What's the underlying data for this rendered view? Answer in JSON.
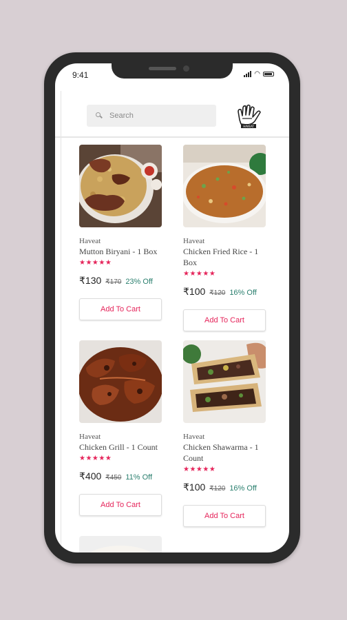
{
  "status_bar": {
    "time": "9:41"
  },
  "search": {
    "placeholder": "Search"
  },
  "theme": {
    "accent": "#e5245a",
    "discount": "#2a7f6e"
  },
  "products": [
    {
      "brand": "Haveat",
      "name": "Mutton Biryani - 1 Box",
      "rating": "★★★★★",
      "price": "₹130",
      "mrp": "₹170",
      "discount": "23% Off",
      "button": "Add To Cart",
      "image": "mutton-biryani"
    },
    {
      "brand": "Haveat",
      "name": "Chicken Fried Rice - 1 Box",
      "rating": "★★★★★",
      "price": "₹100",
      "mrp": "₹120",
      "discount": "16% Off",
      "button": "Add To Cart",
      "image": "chicken-fried-rice"
    },
    {
      "brand": "Haveat",
      "name": "Chicken Grill - 1 Count",
      "rating": "★★★★★",
      "price": "₹400",
      "mrp": "₹450",
      "discount": "11% Off",
      "button": "Add To Cart",
      "image": "chicken-grill"
    },
    {
      "brand": "Haveat",
      "name": "Chicken Shawarma - 1 Count",
      "rating": "★★★★★",
      "price": "₹100",
      "mrp": "₹120",
      "discount": "16% Off",
      "button": "Add To Cart",
      "image": "chicken-shawarma"
    }
  ]
}
